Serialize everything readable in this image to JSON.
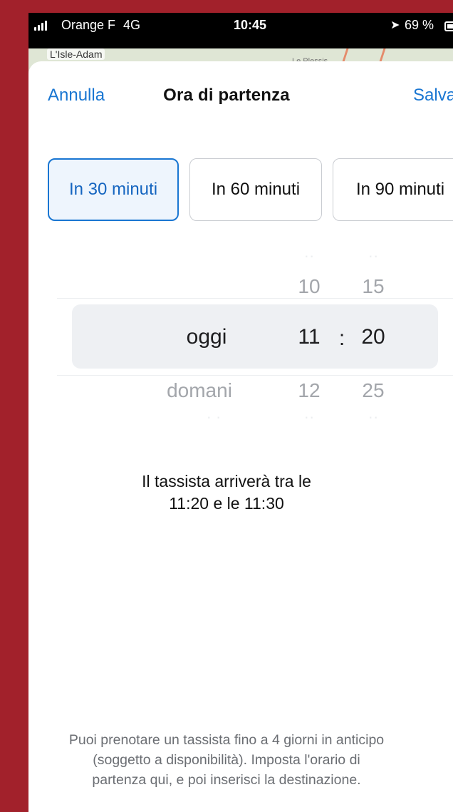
{
  "status_bar": {
    "carrier": "Orange F",
    "network": "4G",
    "time": "10:45",
    "battery": "69 %"
  },
  "map": {
    "place_label": "L'Isle-Adam",
    "place_label_2": "Le Plessis"
  },
  "sheet": {
    "cancel_label": "Annulla",
    "title": "Ora di partenza",
    "save_label": "Salva"
  },
  "quick_options": [
    {
      "label": "In 30 minuti",
      "selected": true
    },
    {
      "label": "In 60 minuti",
      "selected": false
    },
    {
      "label": "In 90 minuti",
      "selected": false
    }
  ],
  "picker": {
    "day": {
      "selected": "oggi",
      "next": "domani"
    },
    "hour": {
      "prev": "10",
      "selected": "11",
      "next": "12"
    },
    "separator": ":",
    "minute": {
      "prev": "15",
      "selected": "20",
      "next": "25"
    }
  },
  "arrival": {
    "line1": "Il tassista arriverà tra le",
    "line2": "11:20 e le 11:30"
  },
  "footnote": {
    "line1": "Puoi prenotare un tassista fino a 4 giorni in anticipo",
    "line2": "(soggetto a disponibilità). Imposta l'orario di",
    "line3": "partenza qui, e poi inserisci la destinazione."
  },
  "colors": {
    "accent": "#1976d2",
    "background_frame": "#a2212b"
  }
}
